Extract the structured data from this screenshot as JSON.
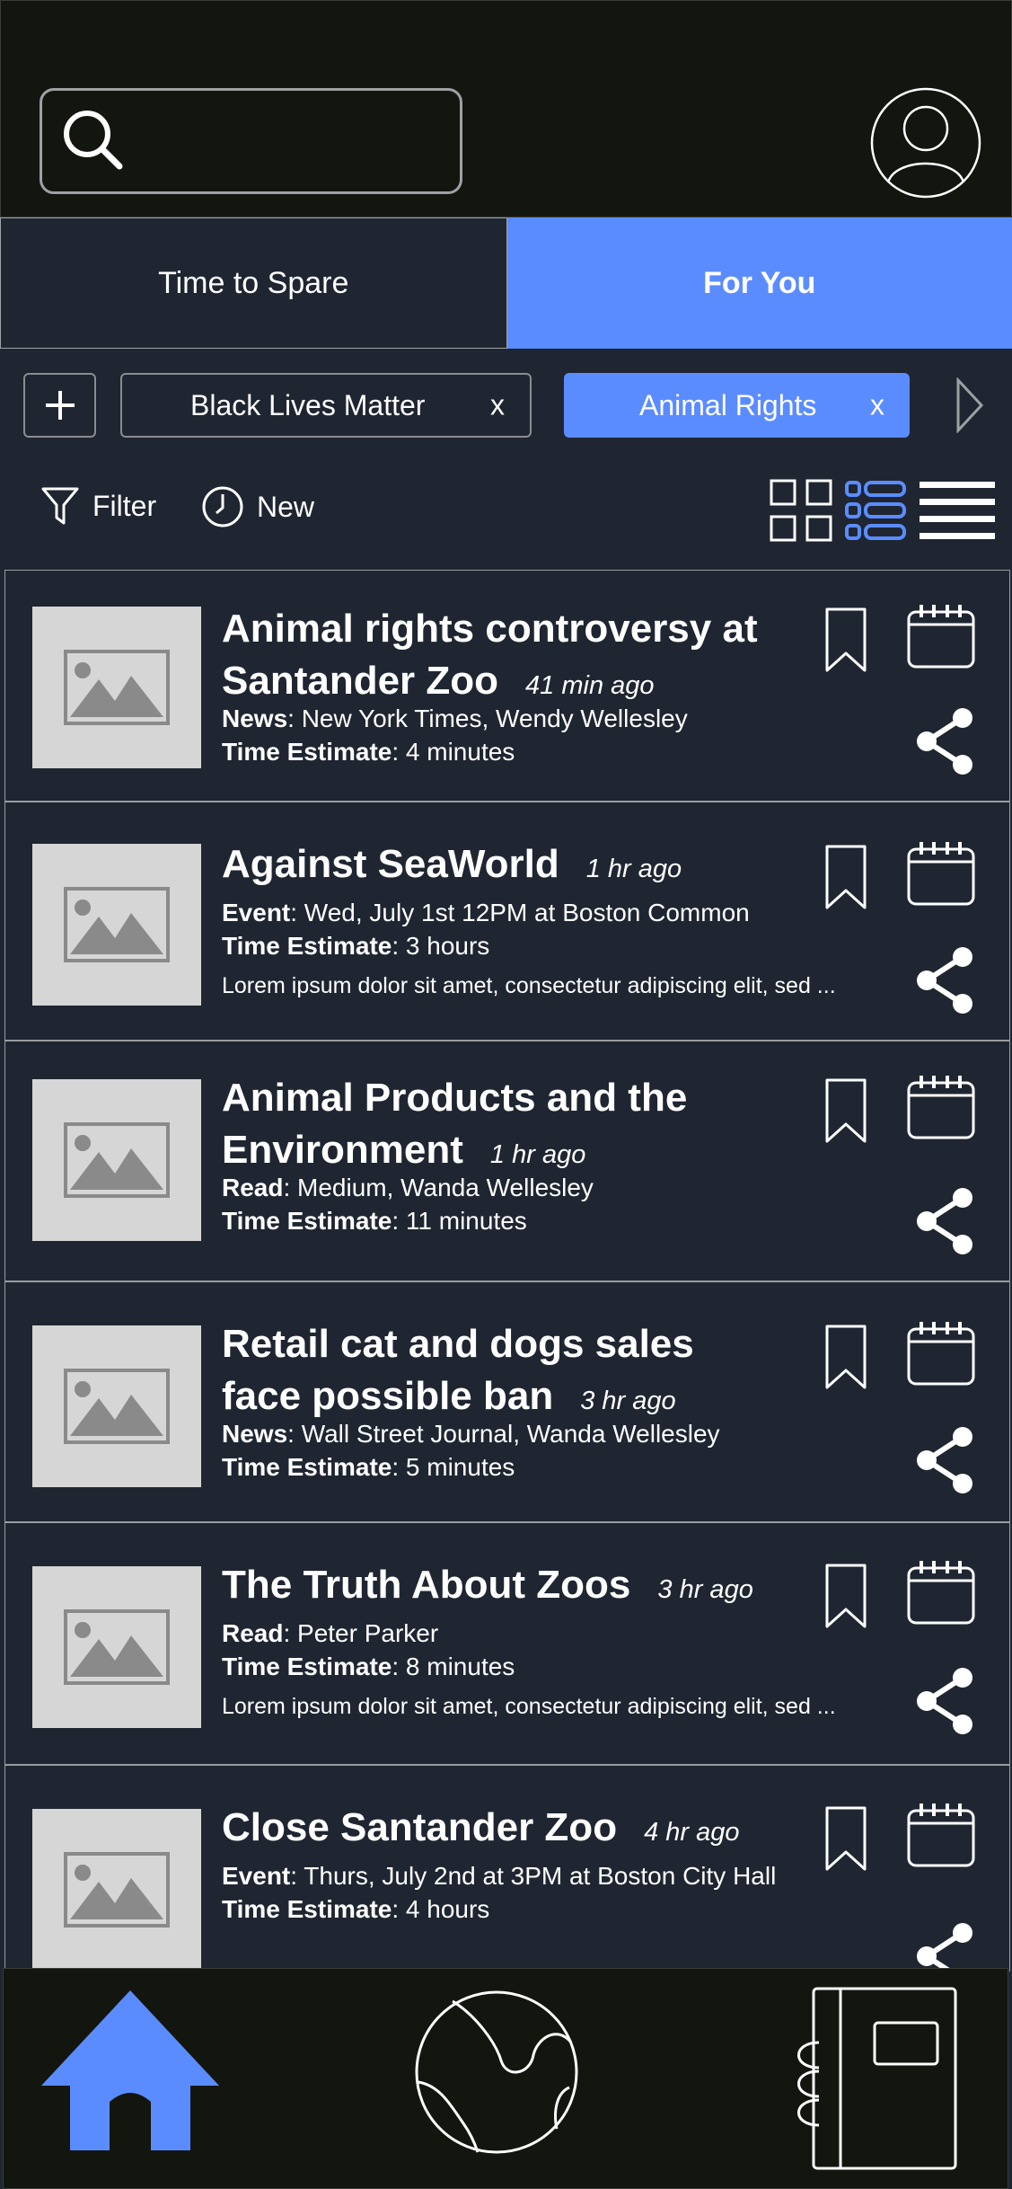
{
  "tabs": {
    "left": "Time to Spare",
    "right": "For You"
  },
  "chips": [
    {
      "label": "Black Lives Matter",
      "remove": "x"
    },
    {
      "label": "Animal Rights",
      "remove": "x"
    }
  ],
  "toolbar": {
    "filter": "Filter",
    "new": "New"
  },
  "items": [
    {
      "title_line1": "Animal rights controversy at",
      "title_line2": "Santander Zoo",
      "ago": "41 min ago",
      "meta1_key": "News",
      "meta1_val": ": New York Times, Wendy Wellesley",
      "meta2_key": "Time Estimate",
      "meta2_val": ": 4 minutes",
      "desc": ""
    },
    {
      "title_line1": "Against SeaWorld",
      "title_line2": "",
      "ago": "1 hr ago",
      "meta1_key": "Event",
      "meta1_val": ": Wed, July 1st 12PM at Boston Common",
      "meta2_key": "Time Estimate",
      "meta2_val": ": 3 hours",
      "desc": "Lorem ipsum dolor sit amet, consectetur adipiscing elit, sed ..."
    },
    {
      "title_line1": "Animal Products and the",
      "title_line2": "Environment",
      "ago": "1 hr ago",
      "meta1_key": "Read",
      "meta1_val": ": Medium, Wanda Wellesley",
      "meta2_key": "Time Estimate",
      "meta2_val": ": 11 minutes",
      "desc": ""
    },
    {
      "title_line1": "Retail cat and dogs sales",
      "title_line2": "face possible ban",
      "ago": "3 hr ago",
      "meta1_key": "News",
      "meta1_val": ": Wall Street Journal, Wanda Wellesley",
      "meta2_key": "Time Estimate",
      "meta2_val": ": 5 minutes",
      "desc": ""
    },
    {
      "title_line1": "The Truth About Zoos",
      "title_line2": "",
      "ago": "3 hr ago",
      "meta1_key": "Read",
      "meta1_val": ": Peter Parker",
      "meta2_key": "Time Estimate",
      "meta2_val": ": 8 minutes",
      "desc": "Lorem ipsum dolor sit amet, consectetur adipiscing elit, sed ..."
    },
    {
      "title_line1": "Close Santander Zoo",
      "title_line2": "",
      "ago": "4 hr ago",
      "meta1_key": "Event",
      "meta1_val": ": Thurs, July 2nd at 3PM at Boston City Hall",
      "meta2_key": "Time Estimate",
      "meta2_val": ": 4 hours",
      "desc": ""
    }
  ],
  "icons": {
    "search": "search-icon",
    "profile": "user-avatar-icon",
    "add": "plus-icon",
    "scroll": "chevron-right-icon",
    "filter": "filter-icon",
    "new": "clock-icon",
    "grid_view": "grid-view-icon",
    "list_view": "list-view-icon",
    "compact_view": "compact-list-icon",
    "bookmark": "bookmark-icon",
    "calendar": "calendar-icon",
    "share": "share-icon",
    "home": "home-icon",
    "globe": "globe-icon",
    "notebook": "notebook-icon"
  },
  "colors": {
    "accent": "#5b8cff",
    "background": "#1f2631",
    "header": "#13160f"
  }
}
